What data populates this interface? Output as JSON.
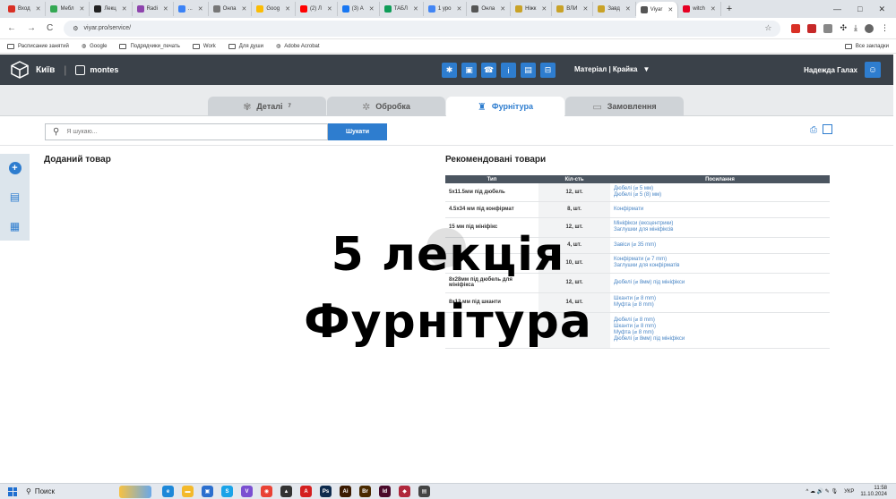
{
  "browser": {
    "tabs": [
      {
        "label": "Вход",
        "color": "#d93025",
        "glyph": "M"
      },
      {
        "label": "Мебл",
        "color": "#34a853",
        "glyph": "▲"
      },
      {
        "label": "Лекц",
        "color": "#222222",
        "glyph": "K"
      },
      {
        "label": "Radi",
        "color": "#8e44ad",
        "glyph": "R"
      },
      {
        "label": "...",
        "color": "#3b82f6",
        "glyph": "W"
      },
      {
        "label": "Онла",
        "color": "#777777",
        "glyph": "◌"
      },
      {
        "label": "Goog",
        "color": "#fbbc04",
        "glyph": "■"
      },
      {
        "label": "(2) Л",
        "color": "#ff0000",
        "glyph": "▶"
      },
      {
        "label": "(3) А",
        "color": "#1877f2",
        "glyph": "∞"
      },
      {
        "label": "ТАБЛ",
        "color": "#0f9d58",
        "glyph": "▦"
      },
      {
        "label": "1 уро",
        "color": "#4285f4",
        "glyph": "●"
      },
      {
        "label": "Онла",
        "color": "#555555",
        "glyph": "—"
      },
      {
        "label": "Ніжк",
        "color": "#c9a227",
        "glyph": "▌"
      },
      {
        "label": "ВЛИ",
        "color": "#c9a227",
        "glyph": "▌"
      },
      {
        "label": "Завд",
        "color": "#c9a227",
        "glyph": "▌"
      },
      {
        "label": "Viyar",
        "color": "#555555",
        "glyph": "◎",
        "active": true
      },
      {
        "label": "witch",
        "color": "#e60023",
        "glyph": "P"
      }
    ],
    "new_tab": "+",
    "window_controls": [
      "—",
      "□",
      "✕"
    ],
    "back": "←",
    "forward": "→",
    "reload": "C",
    "url": "viyar.pro/service/",
    "bookmarks": [
      {
        "label": "Расписание занятий",
        "icon": "folder-icon"
      },
      {
        "label": "Google",
        "icon": "globe-icon"
      },
      {
        "label": "Подрядчики_печать",
        "icon": "folder-icon"
      },
      {
        "label": "Work",
        "icon": "folder-icon"
      },
      {
        "label": "Для души",
        "icon": "folder-icon"
      },
      {
        "label": "Adobe Acrobat",
        "icon": "globe-icon"
      }
    ],
    "bookmarks_all": "Все закладки"
  },
  "app": {
    "city": "Київ",
    "brand": "montes",
    "material": "Матеріал | Крайка",
    "user": "Надежда Галах",
    "tool_icons": [
      "gear-icon",
      "save-icon",
      "support-icon",
      "info-icon",
      "document-icon",
      "trash-icon"
    ],
    "tool_glyphs": [
      "✱",
      "▣",
      "☎",
      "i",
      "▤",
      "⊟"
    ],
    "tabs": [
      {
        "label": "Деталі",
        "badge": "7",
        "icon": "details-icon",
        "glyph": "✾"
      },
      {
        "label": "Обробка",
        "badge": "",
        "icon": "processing-icon",
        "glyph": "✲"
      },
      {
        "label": "Фурнітура",
        "badge": "",
        "icon": "hardware-icon",
        "glyph": "♜",
        "active": true
      },
      {
        "label": "Замовлення",
        "badge": "",
        "icon": "order-icon",
        "glyph": "▭"
      }
    ],
    "search": {
      "placeholder": "Я шукаю...",
      "button": "Шукати"
    },
    "added_title": "Доданий товар",
    "recommended_title": "Рекомендовані товари",
    "table": {
      "headers": [
        "Тип",
        "Кіл-сть",
        "Посилання"
      ],
      "rows": [
        {
          "type": "5х11.5мм під дюбель",
          "qty": "12, шт.",
          "links": [
            "Дюбелі (⌀ 5 мм)",
            "Дюбелі (⌀ 5 (8) мм)"
          ]
        },
        {
          "type": "4.5х34 мм під конфірмат",
          "qty": "8, шт.",
          "links": [
            "Конфірмати"
          ]
        },
        {
          "type": "15 мм під мініфікс",
          "qty": "12, шт.",
          "links": [
            "Мініфікси (ексцентрики)",
            "Заглушки для мініфіксів"
          ]
        },
        {
          "type": "",
          "qty": "4, шт.",
          "links": [
            "Завіси (⌀ 35 mm)"
          ]
        },
        {
          "type": "",
          "qty": "10, шт.",
          "links": [
            "Конфірмати (⌀ 7 mm)",
            "Заглушки для конфірматів"
          ]
        },
        {
          "type": "8х28мм під дюбель для мініфікса",
          "qty": "12, шт.",
          "links": [
            "Дюбелі (⌀ 8мм) під мініфікси"
          ]
        },
        {
          "type": "8х12 мм під шканти",
          "qty": "14, шт.",
          "links": [
            "Шканти (⌀ 8 mm)",
            "Муфта (⌀ 8 mm)"
          ]
        },
        {
          "type": "",
          "qty": "",
          "links": [
            "Дюбелі (⌀ 8 mm)",
            "Шканти (⌀ 8 mm)",
            "Муфта (⌀ 8 mm)",
            "Дюбелі (⌀ 8мм) під мініфікси"
          ]
        }
      ]
    }
  },
  "overlay": {
    "line1": "5 лекція",
    "line2": "Фурнітура"
  },
  "taskbar": {
    "search_label": "Поиск",
    "apps": [
      {
        "name": "edge-icon",
        "color": "#1e88d8",
        "glyph": "e"
      },
      {
        "name": "explorer-icon",
        "color": "#f3b92b",
        "glyph": "▬"
      },
      {
        "name": "store-icon",
        "color": "#2b6fce",
        "glyph": "▣"
      },
      {
        "name": "skype-icon",
        "color": "#1aa3e8",
        "glyph": "S"
      },
      {
        "name": "viber-icon",
        "color": "#7b4fd1",
        "glyph": "V"
      },
      {
        "name": "chrome-icon",
        "color": "#e94235",
        "glyph": "◉"
      },
      {
        "name": "app-icon",
        "color": "#333333",
        "glyph": "▲"
      },
      {
        "name": "acrobat-icon",
        "color": "#d42020",
        "glyph": "A"
      },
      {
        "name": "photoshop-icon",
        "color": "#0e2b4d",
        "glyph": "Ps"
      },
      {
        "name": "illustrator-icon",
        "color": "#3a1a00",
        "glyph": "Ai"
      },
      {
        "name": "bridge-icon",
        "color": "#4a2a00",
        "glyph": "Br"
      },
      {
        "name": "indesign-icon",
        "color": "#4a0a2a",
        "glyph": "Id"
      },
      {
        "name": "app2-icon",
        "color": "#b0283c",
        "glyph": "◆"
      },
      {
        "name": "app3-icon",
        "color": "#444444",
        "glyph": "▤"
      }
    ],
    "tray": {
      "lang": "УКР",
      "time": "11:58",
      "date": "11.10.2024",
      "glyphs": "^ ☁ 🔊 ✎ 🎙"
    }
  },
  "colors": {
    "accent": "#2e7dcf",
    "header": "#3a4149"
  }
}
